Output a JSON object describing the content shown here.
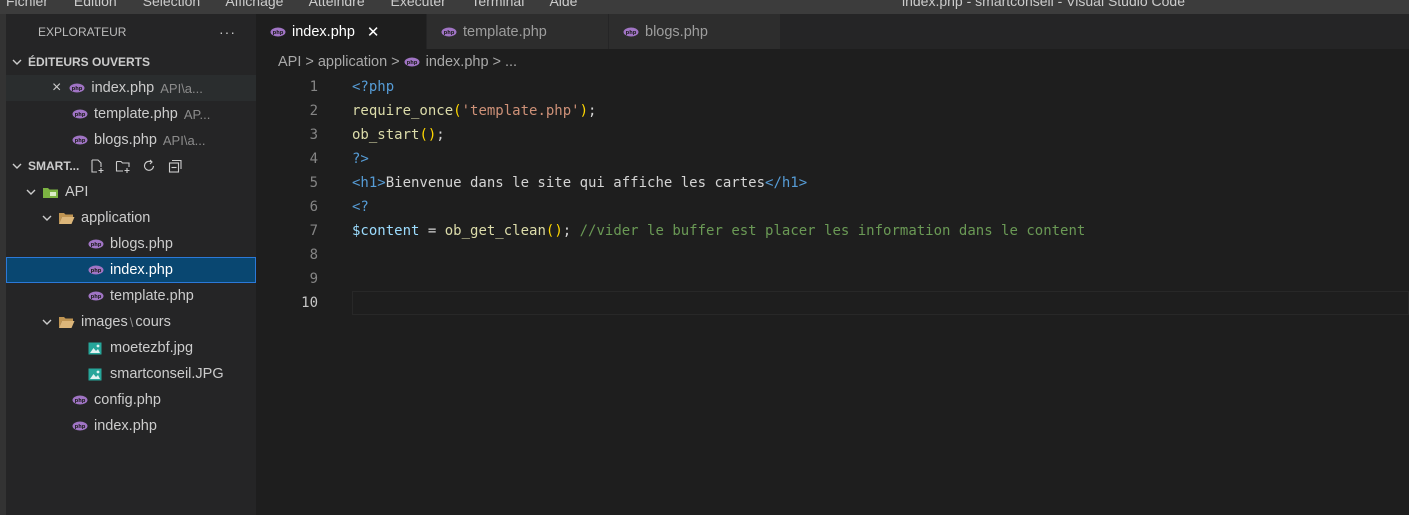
{
  "menubar": {
    "items": [
      "Fichier",
      "Edition",
      "Sélection",
      "Affichage",
      "Atteindre",
      "Exécuter",
      "Terminal",
      "Aide"
    ],
    "window_title": "index.php - smartconseil - Visual Studio Code"
  },
  "sidebar": {
    "title": "EXPLORATEUR",
    "more": "···",
    "open_editors": {
      "label": "ÉDITEURS OUVERTS",
      "items": [
        {
          "name": "index.php",
          "path": "API\\a...",
          "close": "×"
        },
        {
          "name": "template.php",
          "path": "AP..."
        },
        {
          "name": "blogs.php",
          "path": "API\\a..."
        }
      ]
    },
    "workspace": {
      "label": "SMART...",
      "root": "API",
      "application": "application",
      "app_files": [
        "blogs.php",
        "index.php",
        "template.php"
      ],
      "images_folder": "images",
      "images_sep": "\\",
      "images_sub": "cours",
      "image_files": [
        "moetezbf.jpg",
        "smartconseil.JPG"
      ],
      "root_files": [
        "config.php",
        "index.php"
      ]
    }
  },
  "tabs": [
    {
      "label": "index.php",
      "close": "✕",
      "active": true
    },
    {
      "label": "template.php",
      "active": false
    },
    {
      "label": "blogs.php",
      "active": false
    }
  ],
  "breadcrumb": {
    "parts": [
      "API",
      "application",
      "index.php",
      "..."
    ],
    "sep": ">"
  },
  "editor": {
    "line_numbers": [
      "1",
      "2",
      "3",
      "4",
      "5",
      "6",
      "7",
      "8",
      "9",
      "10"
    ],
    "line1": {
      "open": "<?php"
    },
    "line2": {
      "fn": "require_once",
      "lp": "(",
      "str": "'template.php'",
      "rp": ")",
      "semi": ";"
    },
    "line3": {
      "fn": "ob_start",
      "parens": "()",
      "semi": ";"
    },
    "line4": {
      "close": "?>"
    },
    "line5": {
      "open_tag": "<h1>",
      "text": "Bienvenue dans le site qui affiche les cartes",
      "close_tag": "</h1>"
    },
    "line6": {
      "open": "<?"
    },
    "line7": {
      "var": "$content",
      "eq": " = ",
      "fn": "ob_get_clean",
      "parens": "()",
      "semi": "; ",
      "comment": "//vider le buffer est placer les information dans le content"
    }
  },
  "colors": {
    "accent_selection": "#094771",
    "editor_bg": "#1e1e1e",
    "sidebar_bg": "#252526",
    "php_icon": "#a074c4",
    "folder_icon": "#dcb67a",
    "image_icon": "#26a69a"
  }
}
